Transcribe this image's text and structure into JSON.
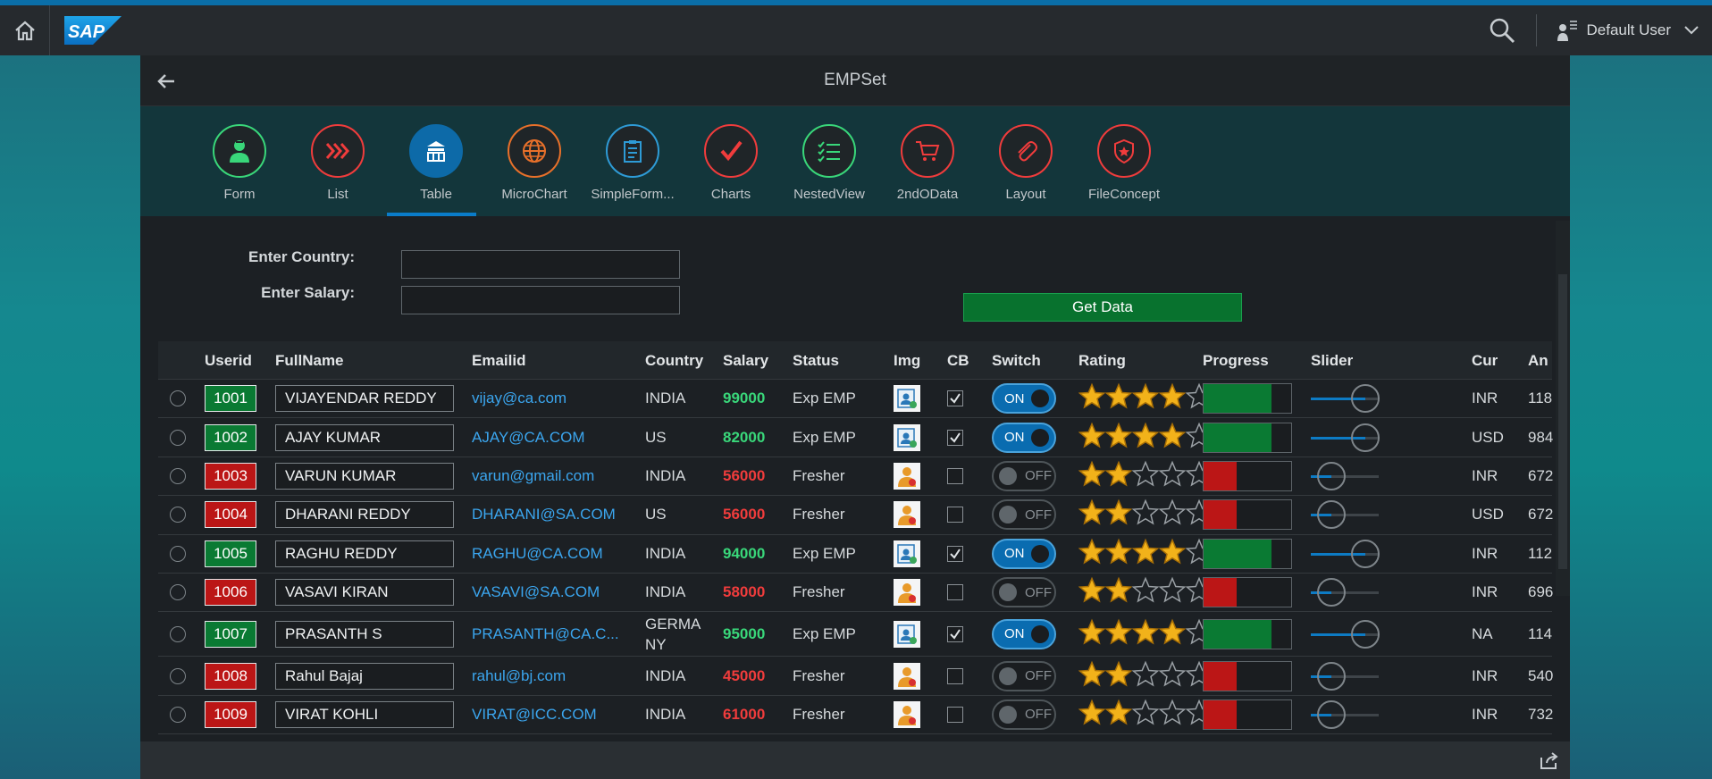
{
  "shell": {
    "user_name": "Default User",
    "colors": {
      "accent": "#0a6ea8",
      "shellbar": "#262a2e"
    }
  },
  "app": {
    "title": "EMPSet",
    "tabs": [
      {
        "label": "Form",
        "icon": "user-icon",
        "color": "#39d77a",
        "active": false
      },
      {
        "label": "List",
        "icon": "forward-icon",
        "color": "#f03c3c",
        "active": false
      },
      {
        "label": "Table",
        "icon": "table-icon",
        "color": "#0d6aa8",
        "active": true
      },
      {
        "label": "MicroChart",
        "icon": "globe-icon",
        "color": "#e8702a",
        "active": false
      },
      {
        "label": "SimpleForm...",
        "icon": "clipboard-icon",
        "color": "#2e9bd6",
        "active": false
      },
      {
        "label": "Charts",
        "icon": "checkmark-icon",
        "color": "#f03c3c",
        "active": false
      },
      {
        "label": "NestedView",
        "icon": "checklist-icon",
        "color": "#39d77a",
        "active": false
      },
      {
        "label": "2ndOData",
        "icon": "cart-icon",
        "color": "#f03c3c",
        "active": false
      },
      {
        "label": "Layout",
        "icon": "attachment-icon",
        "color": "#f03c3c",
        "active": false
      },
      {
        "label": "FileConcept",
        "icon": "badge-icon",
        "color": "#f03c3c",
        "active": false
      }
    ]
  },
  "filters": {
    "country_label": "Enter Country:",
    "country_value": "",
    "salary_label": "Enter Salary:",
    "salary_value": "",
    "get_data_label": "Get Data"
  },
  "table": {
    "columns": [
      "Userid",
      "FullName",
      "Emailid",
      "Country",
      "Salary",
      "Status",
      "Img",
      "CB",
      "Switch",
      "Rating",
      "Progress",
      "Slider",
      "Cur",
      "An"
    ],
    "rows": [
      {
        "userid": "1001",
        "fullname": "VIJAYENDAR REDDY",
        "email": "vijay@ca.com",
        "country": "INDIA",
        "salary": "99000",
        "status": "Exp EMP",
        "checked": true,
        "switch": "ON",
        "rating": 4,
        "progress": 0.78,
        "slider": 0.8,
        "cur": "INR",
        "an": "118"
      },
      {
        "userid": "1002",
        "fullname": "AJAY KUMAR",
        "email": "AJAY@CA.COM",
        "country": "US",
        "salary": "82000",
        "status": "Exp EMP",
        "checked": true,
        "switch": "ON",
        "rating": 4,
        "progress": 0.78,
        "slider": 0.8,
        "cur": "USD",
        "an": "984"
      },
      {
        "userid": "1003",
        "fullname": "VARUN KUMAR",
        "email": "varun@gmail.com",
        "country": "INDIA",
        "salary": "56000",
        "status": "Fresher",
        "checked": false,
        "switch": "OFF",
        "rating": 2,
        "progress": 0.38,
        "slider": 0.3,
        "cur": "INR",
        "an": "672"
      },
      {
        "userid": "1004",
        "fullname": "DHARANI REDDY",
        "email": "DHARANI@SA.COM",
        "country": "US",
        "salary": "56000",
        "status": "Fresher",
        "checked": false,
        "switch": "OFF",
        "rating": 2,
        "progress": 0.38,
        "slider": 0.3,
        "cur": "USD",
        "an": "672"
      },
      {
        "userid": "1005",
        "fullname": "RAGHU REDDY",
        "email": "RAGHU@CA.COM",
        "country": "INDIA",
        "salary": "94000",
        "status": "Exp EMP",
        "checked": true,
        "switch": "ON",
        "rating": 4,
        "progress": 0.78,
        "slider": 0.8,
        "cur": "INR",
        "an": "112"
      },
      {
        "userid": "1006",
        "fullname": "VASAVI KIRAN",
        "email": "VASAVI@SA.COM",
        "country": "INDIA",
        "salary": "58000",
        "status": "Fresher",
        "checked": false,
        "switch": "OFF",
        "rating": 2,
        "progress": 0.38,
        "slider": 0.3,
        "cur": "INR",
        "an": "696"
      },
      {
        "userid": "1007",
        "fullname": "PRASANTH S",
        "email": "PRASANTH@CA.C...",
        "country": "GERMA NY",
        "salary": "95000",
        "status": "Exp EMP",
        "checked": true,
        "switch": "ON",
        "rating": 4,
        "progress": 0.78,
        "slider": 0.8,
        "cur": "NA",
        "an": "114"
      },
      {
        "userid": "1008",
        "fullname": "Rahul Bajaj",
        "email": "rahul@bj.com",
        "country": "INDIA",
        "salary": "45000",
        "status": "Fresher",
        "checked": false,
        "switch": "OFF",
        "rating": 2,
        "progress": 0.38,
        "slider": 0.3,
        "cur": "INR",
        "an": "540"
      },
      {
        "userid": "1009",
        "fullname": "VIRAT KOHLI",
        "email": "VIRAT@ICC.COM",
        "country": "INDIA",
        "salary": "61000",
        "status": "Fresher",
        "checked": false,
        "switch": "OFF",
        "rating": 2,
        "progress": 0.38,
        "slider": 0.3,
        "cur": "INR",
        "an": "732"
      }
    ]
  }
}
